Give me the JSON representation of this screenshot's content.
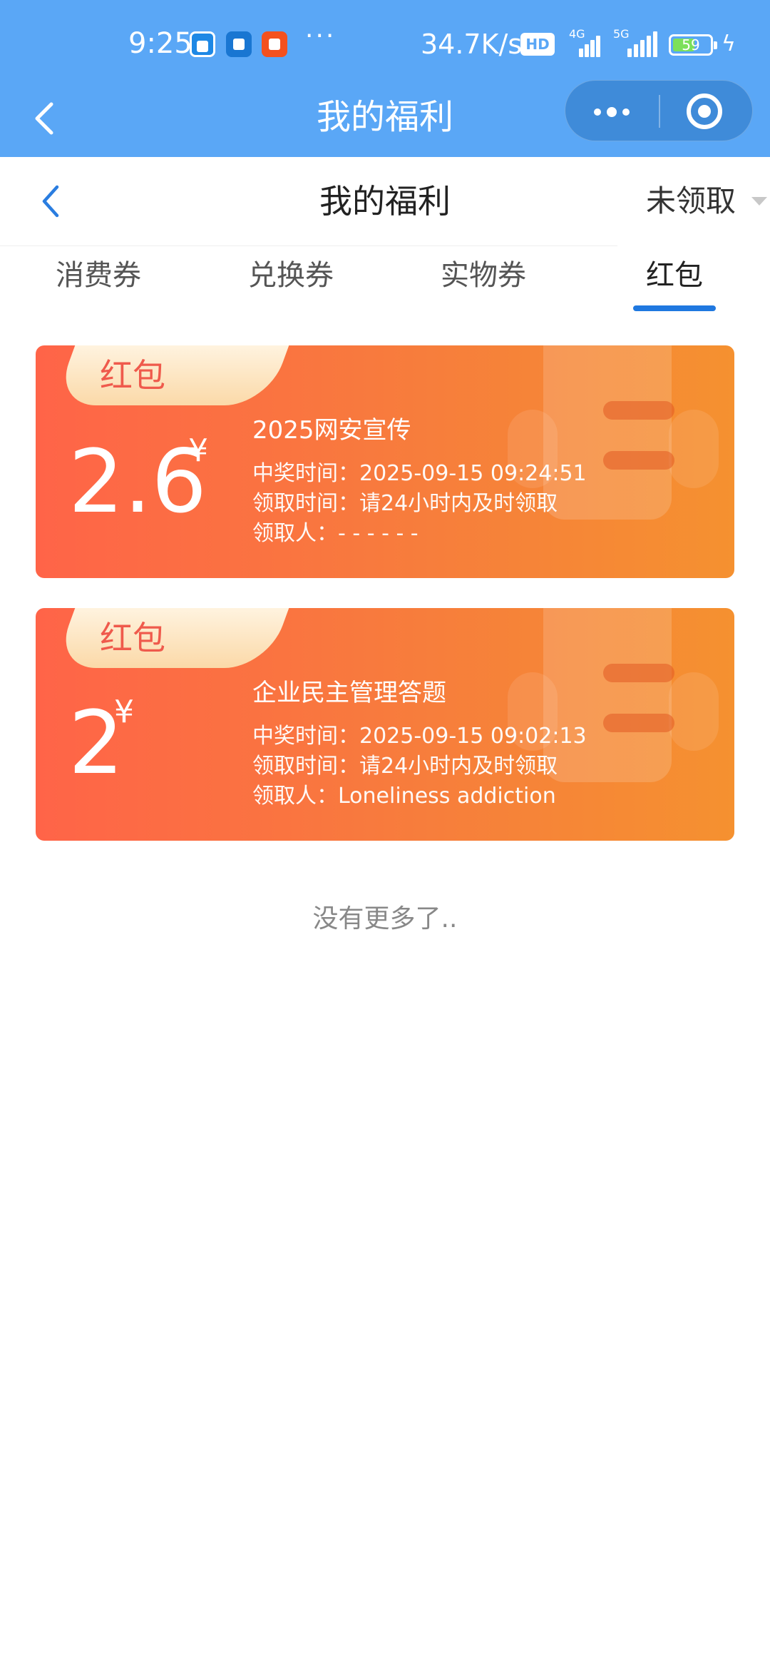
{
  "status_bar": {
    "time": "9:25",
    "notification_more": "···",
    "net_speed": "34.7K/s",
    "hd_label": "HD",
    "signal1_label": "4G",
    "signal2_label": "5G",
    "battery": "59",
    "colors": {
      "bar_bg": "#5aa7f6",
      "battery_fill": "#7ce05a"
    }
  },
  "navbar": {
    "title": "我的福利"
  },
  "page_header": {
    "title": "我的福利",
    "filter_label": "未领取"
  },
  "tabs": [
    {
      "label": "消费券",
      "active": false
    },
    {
      "label": "兑换券",
      "active": false
    },
    {
      "label": "实物券",
      "active": false
    },
    {
      "label": "红包",
      "active": true
    }
  ],
  "cards": [
    {
      "tag": "红包",
      "amount": "2.6",
      "currency": "¥",
      "title": "2025网安宣传",
      "win_time": "中奖时间：2025-09-15 09:24:51",
      "claim_time": "领取时间：请24小时内及时领取",
      "claimer": "领取人：- - - - - -"
    },
    {
      "tag": "红包",
      "amount": "2",
      "currency": "¥",
      "title": "企业民主管理答题",
      "win_time": "中奖时间：2025-09-15 09:02:13",
      "claim_time": "领取时间：请24小时内及时领取",
      "claimer": "领取人：Loneliness addiction"
    }
  ],
  "footer": {
    "no_more": "没有更多了.."
  },
  "theme": {
    "accent": "#1f78e0",
    "card_start": "#ff6448",
    "card_end": "#f59130",
    "tag_text": "#ef5a4c"
  }
}
